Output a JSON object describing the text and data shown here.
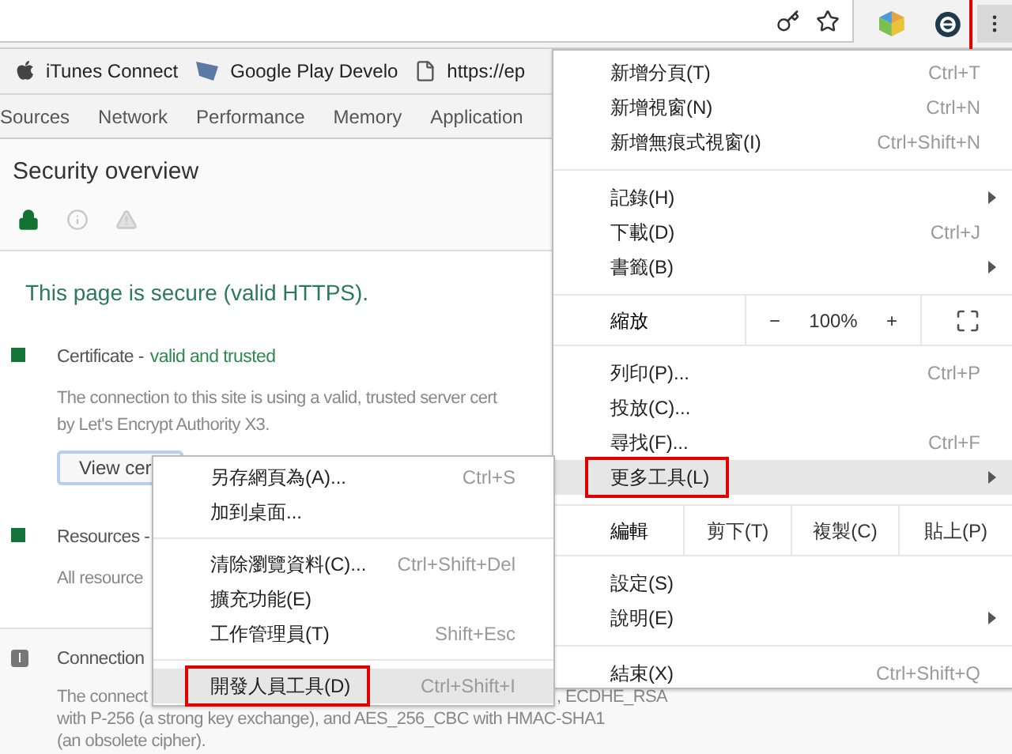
{
  "menu_button": {
    "annotated": true
  },
  "bookmarks": [
    {
      "label": "iTunes Connect",
      "kind": "apple"
    },
    {
      "label": "Google Play Develo",
      "kind": "flag"
    },
    {
      "label": "https://ep",
      "kind": "page"
    }
  ],
  "devtools_tabs": [
    {
      "label": "Sources",
      "selected": false
    },
    {
      "label": "Network",
      "selected": false
    },
    {
      "label": "Performance",
      "selected": false
    },
    {
      "label": "Memory",
      "selected": false
    },
    {
      "label": "Application",
      "selected": false
    }
  ],
  "security": {
    "title": "Security overview",
    "filters": [
      {
        "kind": "secure",
        "selected": true
      },
      {
        "kind": "info",
        "selected": false
      },
      {
        "kind": "warning",
        "selected": false
      }
    ],
    "summary": "This page is secure (valid HTTPS).",
    "sections": [
      {
        "kind": "ok",
        "color": "#13753a",
        "title": "Certificate -",
        "status": "valid and trusted",
        "lines": [
          [
            "The connection to this site is using a valid, trusted server cert"
          ],
          [
            "by Let's Encrypt Authority X3."
          ]
        ],
        "button": "View cer"
      },
      {
        "kind": "ok",
        "color": "#13753a",
        "title": "Resources -",
        "lines": [
          [
            "All resource"
          ]
        ]
      },
      {
        "kind": "info",
        "title": "Connection",
        "lines": [
          [
            "The connect",
            ", ECDHE_RSA"
          ],
          [
            "with P-256 (a strong key exchange), and AES_256_CBC with HMAC-SHA1"
          ],
          [
            "(an obsolete cipher)."
          ]
        ]
      }
    ]
  },
  "main_menu": {
    "groups": [
      [
        {
          "kind": "item",
          "label": "新增分頁(T)",
          "shortcut": "Ctrl+T",
          "has_submenu": false,
          "selected": false,
          "annotated": false
        },
        {
          "kind": "item",
          "label": "新增視窗(N)",
          "shortcut": "Ctrl+N",
          "has_submenu": false,
          "selected": false,
          "annotated": false
        },
        {
          "kind": "item",
          "label": "新增無痕式視窗(I)",
          "shortcut": "Ctrl+Shift+N",
          "has_submenu": false,
          "selected": false,
          "annotated": false
        }
      ],
      [
        {
          "kind": "item",
          "label": "記錄(H)",
          "has_submenu": true,
          "selected": false,
          "annotated": false
        },
        {
          "kind": "item",
          "label": "下載(D)",
          "shortcut": "Ctrl+J",
          "has_submenu": false,
          "selected": false,
          "annotated": false
        },
        {
          "kind": "item",
          "label": "書籤(B)",
          "has_submenu": true,
          "selected": false,
          "annotated": false
        }
      ],
      [
        {
          "kind": "zoom",
          "label": "縮放",
          "minus": "−",
          "value": "100%",
          "plus": "+"
        }
      ],
      [
        {
          "kind": "item",
          "label": "列印(P)...",
          "shortcut": "Ctrl+P",
          "has_submenu": false,
          "selected": false,
          "annotated": false
        },
        {
          "kind": "item",
          "label": "投放(C)...",
          "has_submenu": false,
          "selected": false,
          "annotated": false
        },
        {
          "kind": "item",
          "label": "尋找(F)...",
          "shortcut": "Ctrl+F",
          "has_submenu": false,
          "selected": false,
          "annotated": false
        },
        {
          "kind": "item",
          "label": "更多工具(L)",
          "has_submenu": true,
          "selected": true,
          "annotated": true
        }
      ],
      [
        {
          "kind": "edit",
          "label": "編輯",
          "actions": [
            "剪下(T)",
            "複製(C)",
            "貼上(P)"
          ]
        }
      ],
      [
        {
          "kind": "item",
          "label": "設定(S)",
          "has_submenu": false,
          "selected": false,
          "annotated": false
        },
        {
          "kind": "item",
          "label": "說明(E)",
          "has_submenu": true,
          "selected": false,
          "annotated": false
        }
      ],
      [
        {
          "kind": "item",
          "label": "結束(X)",
          "shortcut": "Ctrl+Shift+Q",
          "has_submenu": false,
          "selected": false,
          "annotated": false
        }
      ]
    ]
  },
  "submenu": {
    "groups": [
      [
        {
          "kind": "item",
          "label": "另存網頁為(A)...",
          "shortcut": "Ctrl+S",
          "selected": false,
          "annotated": false
        },
        {
          "kind": "item",
          "label": "加到桌面...",
          "selected": false,
          "annotated": false
        }
      ],
      [
        {
          "kind": "item",
          "label": "清除瀏覽資料(C)...",
          "shortcut": "Ctrl+Shift+Del",
          "selected": false,
          "annotated": false
        },
        {
          "kind": "item",
          "label": "擴充功能(E)",
          "selected": false,
          "annotated": false
        },
        {
          "kind": "item",
          "label": "工作管理員(T)",
          "shortcut": "Shift+Esc",
          "selected": false,
          "annotated": false
        }
      ],
      [
        {
          "kind": "item",
          "label": "開發人員工具(D)",
          "shortcut": "Ctrl+Shift+I",
          "selected": true,
          "annotated": true
        }
      ]
    ]
  }
}
